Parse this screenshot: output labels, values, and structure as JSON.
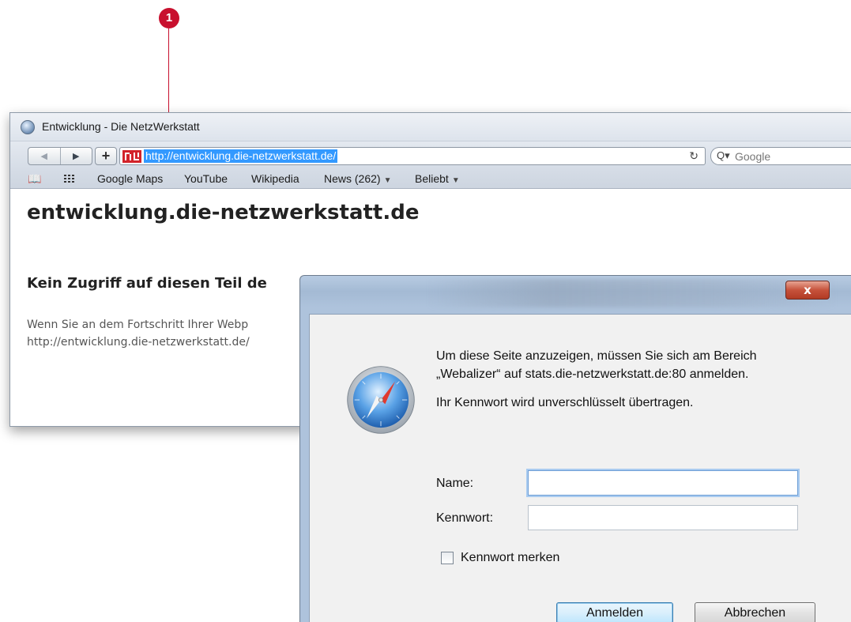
{
  "callout": {
    "number": "1"
  },
  "browser": {
    "title": "Entwicklung - Die NetzWerkstatt",
    "url": "http://entwicklung.die-netzwerkstatt.de/",
    "search_placeholder": "Google",
    "bookmarks": [
      {
        "label": "Google Maps"
      },
      {
        "label": "YouTube"
      },
      {
        "label": "Wikipedia"
      },
      {
        "label": "News (262)",
        "has_menu": true
      },
      {
        "label": "Beliebt",
        "has_menu": true
      }
    ],
    "page": {
      "heading": "entwicklung.die-netzwerkstatt.de",
      "subheading": "Kein Zugriff auf diesen Teil de",
      "paragraph_line1": "Wenn Sie an dem Fortschritt Ihrer Webp",
      "paragraph_line2": "http://entwicklung.die-netzwerkstatt.de/"
    }
  },
  "dialog": {
    "close_label": "x",
    "message_line1": "Um diese Seite anzuzeigen, müssen Sie sich am Bereich",
    "message_line2": "„Webalizer“ auf stats.die-netzwerkstatt.de:80 anmelden.",
    "security_note": "Ihr Kennwort wird unverschlüsselt übertragen.",
    "name_label": "Name:",
    "name_value": "",
    "password_label": "Kennwort:",
    "password_value": "",
    "remember_label": "Kennwort merken",
    "remember_checked": false,
    "login_button": "Anmelden",
    "cancel_button": "Abbrechen"
  },
  "colors": {
    "callout": "#c8102e",
    "url_highlight": "#3399ff",
    "close_button": "#c6523b"
  }
}
